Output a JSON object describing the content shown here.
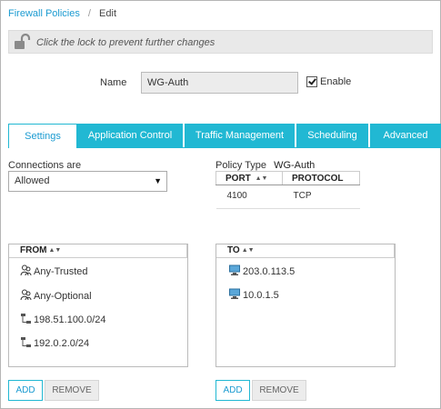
{
  "breadcrumb": {
    "link": "Firewall Policies",
    "separator": "/",
    "current": "Edit"
  },
  "lockbar": {
    "text": "Click the lock to prevent further changes"
  },
  "name": {
    "label": "Name",
    "value": "WG-Auth"
  },
  "enable": {
    "label": "Enable",
    "checked": true
  },
  "tabs": [
    "Settings",
    "Application Control",
    "Traffic Management",
    "Scheduling",
    "Advanced"
  ],
  "connections": {
    "label": "Connections are",
    "value": "Allowed"
  },
  "policy_type": {
    "label": "Policy Type",
    "value": "WG-Auth"
  },
  "ports": {
    "headers": [
      "PORT",
      "PROTOCOL"
    ],
    "rows": [
      [
        "4100",
        "TCP"
      ]
    ]
  },
  "from": {
    "header": "FROM",
    "items": [
      {
        "label": "Any-Trusted",
        "icon": "user-group-icon"
      },
      {
        "label": "Any-Optional",
        "icon": "user-group-icon"
      },
      {
        "label": "198.51.100.0/24",
        "icon": "network-icon"
      },
      {
        "label": "192.0.2.0/24",
        "icon": "network-icon"
      }
    ]
  },
  "to": {
    "header": "TO",
    "items": [
      {
        "label": "203.0.113.5",
        "icon": "host-icon"
      },
      {
        "label": "10.0.1.5",
        "icon": "host-icon"
      }
    ]
  },
  "buttons": {
    "add": "ADD",
    "remove": "REMOVE"
  },
  "colors": {
    "accent": "#21b8d3",
    "link": "#1b9bd1"
  }
}
